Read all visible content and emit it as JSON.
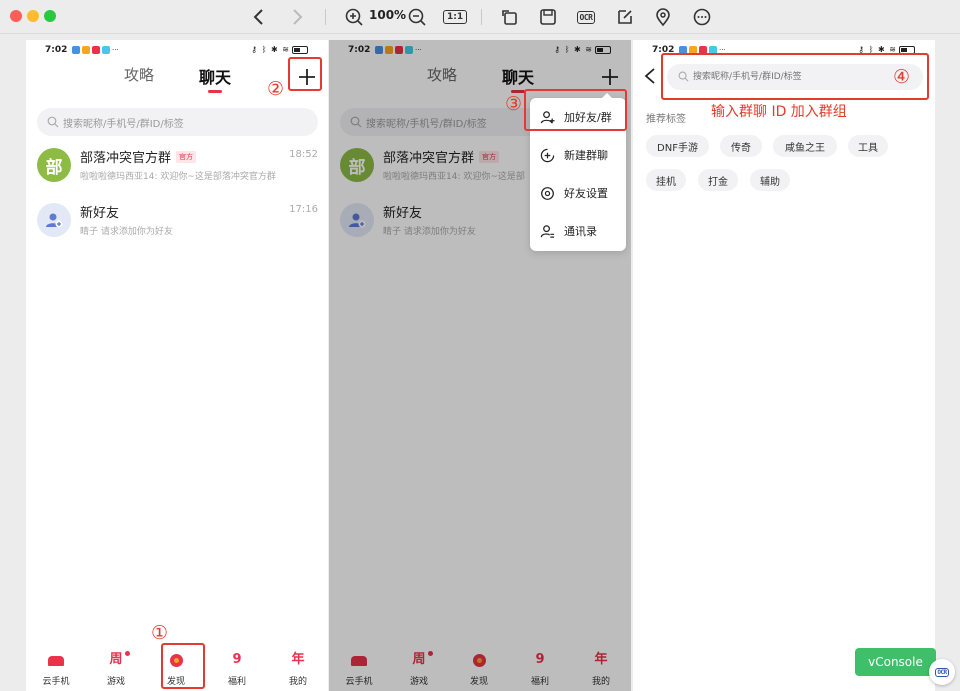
{
  "viewer": {
    "zoom": "100%",
    "one_to_one": "1:1",
    "ocr": "OCR",
    "side_arrow": "‹"
  },
  "status_bar": {
    "time": "7:02",
    "dots": "···"
  },
  "tabs": {
    "gonglue": "攻略",
    "liaotian": "聊天"
  },
  "search": {
    "placeholder": "搜索昵称/手机号/群ID/标签"
  },
  "conversations": [
    {
      "avatar_text": "部",
      "name": "部落冲突官方群",
      "badge": "官方",
      "time": "18:52",
      "preview": "啦啦啦德玛西亚14: 欢迎你~这是部落冲突官方群"
    },
    {
      "name": "新好友",
      "time": "17:16",
      "preview": "睛子 请求添加你为好友"
    }
  ],
  "panel2_preview_1": "啦啦啦德玛西亚14: 欢迎你~这是部",
  "bottom_nav": [
    {
      "icon_text": "",
      "label": "云手机"
    },
    {
      "icon_text": "周",
      "label": "游戏"
    },
    {
      "icon_text": "",
      "label": "发现"
    },
    {
      "icon_text": "9",
      "label": "福利"
    },
    {
      "icon_text": "年",
      "label": "我的"
    }
  ],
  "dropdown": {
    "add_friend_group": "加好友/群",
    "new_group_chat": "新建群聊",
    "friend_settings": "好友设置",
    "contacts": "通讯录"
  },
  "search_page": {
    "placeholder": "搜索昵称/手机号/群ID/标签",
    "recommend_title": "推荐标签",
    "tags": [
      "DNF手游",
      "传奇",
      "咸鱼之王",
      "工具",
      "挂机",
      "打金",
      "辅助"
    ]
  },
  "annotations": {
    "step1": "①",
    "step2": "②",
    "step3": "③",
    "step4": "④",
    "step4_text": "输入群聊 ID 加入群组"
  },
  "vconsole": "vConsole",
  "colors": {
    "accent": "#e8334a",
    "annotation": "#e33b2e",
    "vconsole": "#3fbf6a"
  }
}
